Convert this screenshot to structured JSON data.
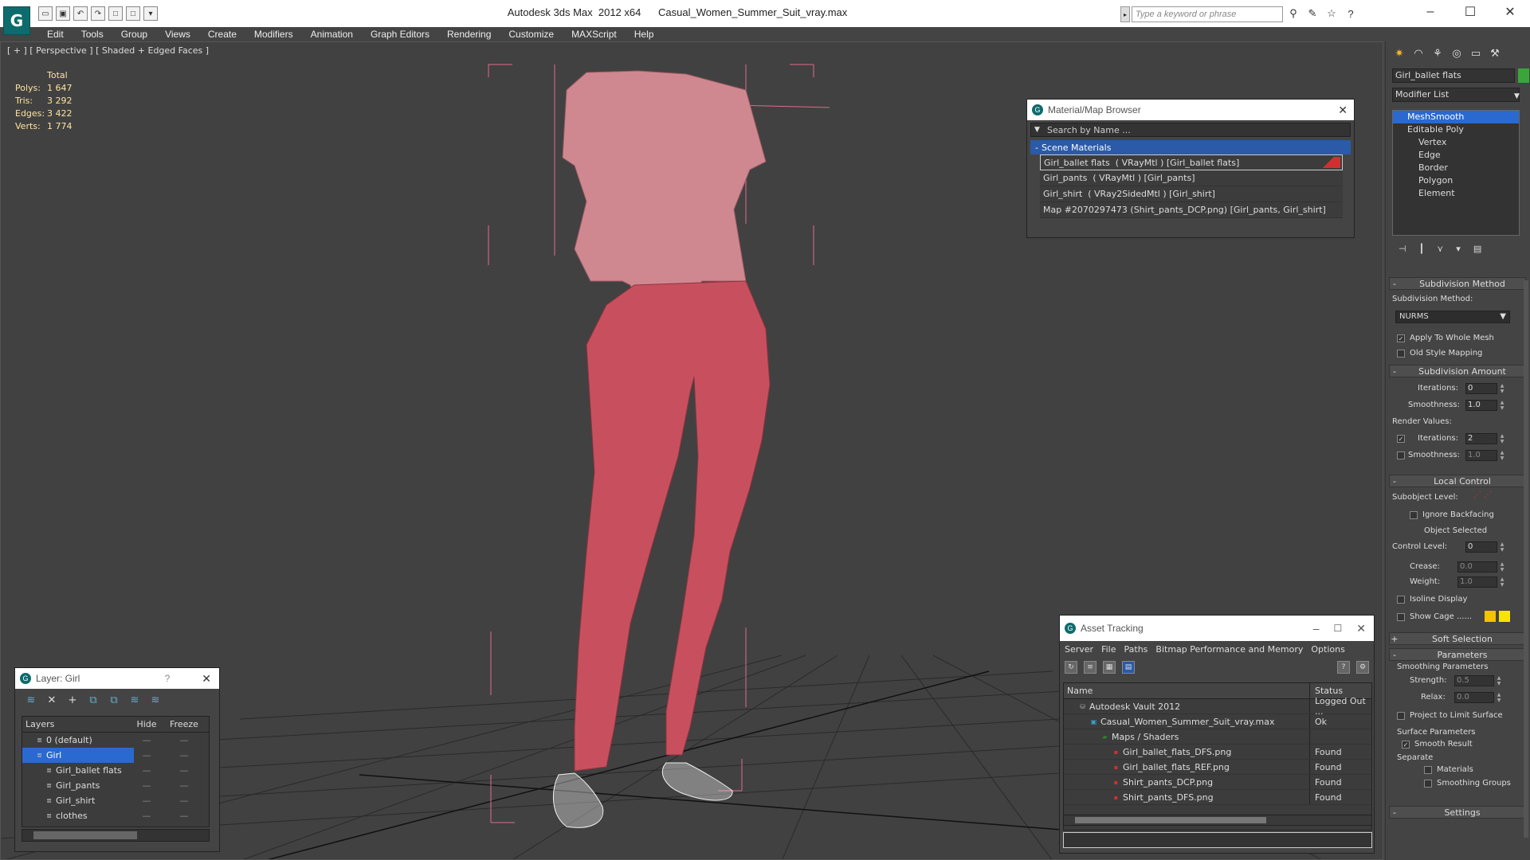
{
  "titlebar": {
    "app": "Autodesk 3ds Max  2012 x64",
    "file": "Casual_Women_Summer_Suit_vray.max",
    "search_placeholder": "Type a keyword or phrase"
  },
  "menu": [
    "Edit",
    "Tools",
    "Group",
    "Views",
    "Create",
    "Modifiers",
    "Animation",
    "Graph Editors",
    "Rendering",
    "Customize",
    "MAXScript",
    "Help"
  ],
  "viewport": {
    "label": "[ + ] [ Perspective ] [ Shaded + Edged Faces ]",
    "stats": {
      "header": "Total",
      "rows": [
        {
          "k": "Polys:",
          "v": "1 647"
        },
        {
          "k": "Tris:",
          "v": "3 292"
        },
        {
          "k": "Edges:",
          "v": "3 422"
        },
        {
          "k": "Verts:",
          "v": "1 774"
        }
      ]
    },
    "mesh_color": "#c8505e",
    "bbox_color": "#e06b8c"
  },
  "material_browser": {
    "title": "Material/Map Browser",
    "search": "Search by Name ...",
    "group": "Scene Materials",
    "items": [
      "Girl_ballet flats  ( VRayMtl ) [Girl_ballet flats]",
      "Girl_pants  ( VRayMtl ) [Girl_pants]",
      "Girl_shirt  ( VRay2SidedMtl ) [Girl_shirt]",
      "Map #2070297473 (Shirt_pants_DCP.png) [Girl_pants, Girl_shirt]"
    ]
  },
  "asset_tracking": {
    "title": "Asset Tracking",
    "menu": [
      "Server",
      "File",
      "Paths",
      "Bitmap Performance and Memory",
      "Options"
    ],
    "columns": [
      "Name",
      "Status"
    ],
    "rows": [
      {
        "name": "Autodesk Vault 2012",
        "status": "Logged Out ...",
        "indent": 1,
        "icon": "vault-icon"
      },
      {
        "name": "Casual_Women_Summer_Suit_vray.max",
        "status": "Ok",
        "indent": 2,
        "icon": "max-file-icon"
      },
      {
        "name": "Maps / Shaders",
        "status": "",
        "indent": 3,
        "icon": "maps-icon"
      },
      {
        "name": "Girl_ballet_flats_DFS.png",
        "status": "Found",
        "indent": 4,
        "icon": "png-icon"
      },
      {
        "name": "Girl_ballet_flats_REF.png",
        "status": "Found",
        "indent": 4,
        "icon": "png-icon"
      },
      {
        "name": "Shirt_pants_DCP.png",
        "status": "Found",
        "indent": 4,
        "icon": "png-icon"
      },
      {
        "name": "Shirt_pants_DFS.png",
        "status": "Found",
        "indent": 4,
        "icon": "png-icon"
      }
    ]
  },
  "layer_panel": {
    "title": "Layer: Girl",
    "columns": [
      "Layers",
      "Hide",
      "Freeze"
    ],
    "rows": [
      {
        "name": "0 (default)",
        "sel": false,
        "indent": 1
      },
      {
        "name": "Girl",
        "sel": true,
        "indent": 1
      },
      {
        "name": "Girl_ballet flats",
        "sel": false,
        "indent": 2
      },
      {
        "name": "Girl_pants",
        "sel": false,
        "indent": 2
      },
      {
        "name": "Girl_shirt",
        "sel": false,
        "indent": 2
      },
      {
        "name": "clothes",
        "sel": false,
        "indent": 2
      }
    ]
  },
  "command_panel": {
    "object_name": "Girl_ballet flats",
    "modifier_list": "Modifier List",
    "stack": [
      "MeshSmooth",
      "Editable Poly",
      "Vertex",
      "Edge",
      "Border",
      "Polygon",
      "Element"
    ],
    "subdivision_method": {
      "title": "Subdivision Method",
      "label": "Subdivision Method:",
      "value": "NURMS",
      "apply_whole": "Apply To Whole Mesh",
      "old_style": "Old Style Mapping"
    },
    "subdivision_amount": {
      "title": "Subdivision Amount",
      "iterations_label": "Iterations:",
      "iterations": "0",
      "smoothness_label": "Smoothness:",
      "smoothness": "1.0",
      "render_values": "Render Values:",
      "r_iterations_label": "Iterations:",
      "r_iterations": "2",
      "r_smoothness_label": "Smoothness:",
      "r_smoothness": "1.0"
    },
    "local_control": {
      "title": "Local Control",
      "subobject": "Subobject Level:",
      "ignore_backfacing": "Ignore Backfacing",
      "object_selected": "Object Selected",
      "control_level_label": "Control Level:",
      "control_level": "0",
      "crease_label": "Crease:",
      "crease": "0.0",
      "weight_label": "Weight:",
      "weight": "1.0",
      "isoline": "Isoline Display",
      "show_cage": "Show Cage ......"
    },
    "soft_selection": "Soft Selection",
    "parameters": {
      "title": "Parameters",
      "smoothing": "Smoothing Parameters",
      "strength_label": "Strength:",
      "strength": "0.5",
      "relax_label": "Relax:",
      "relax": "0.0",
      "project": "Project to Limit Surface",
      "surface": "Surface Parameters",
      "smooth_result": "Smooth Result",
      "separate": "Separate",
      "materials": "Materials",
      "smoothing_groups": "Smoothing Groups"
    },
    "settings": "Settings"
  }
}
